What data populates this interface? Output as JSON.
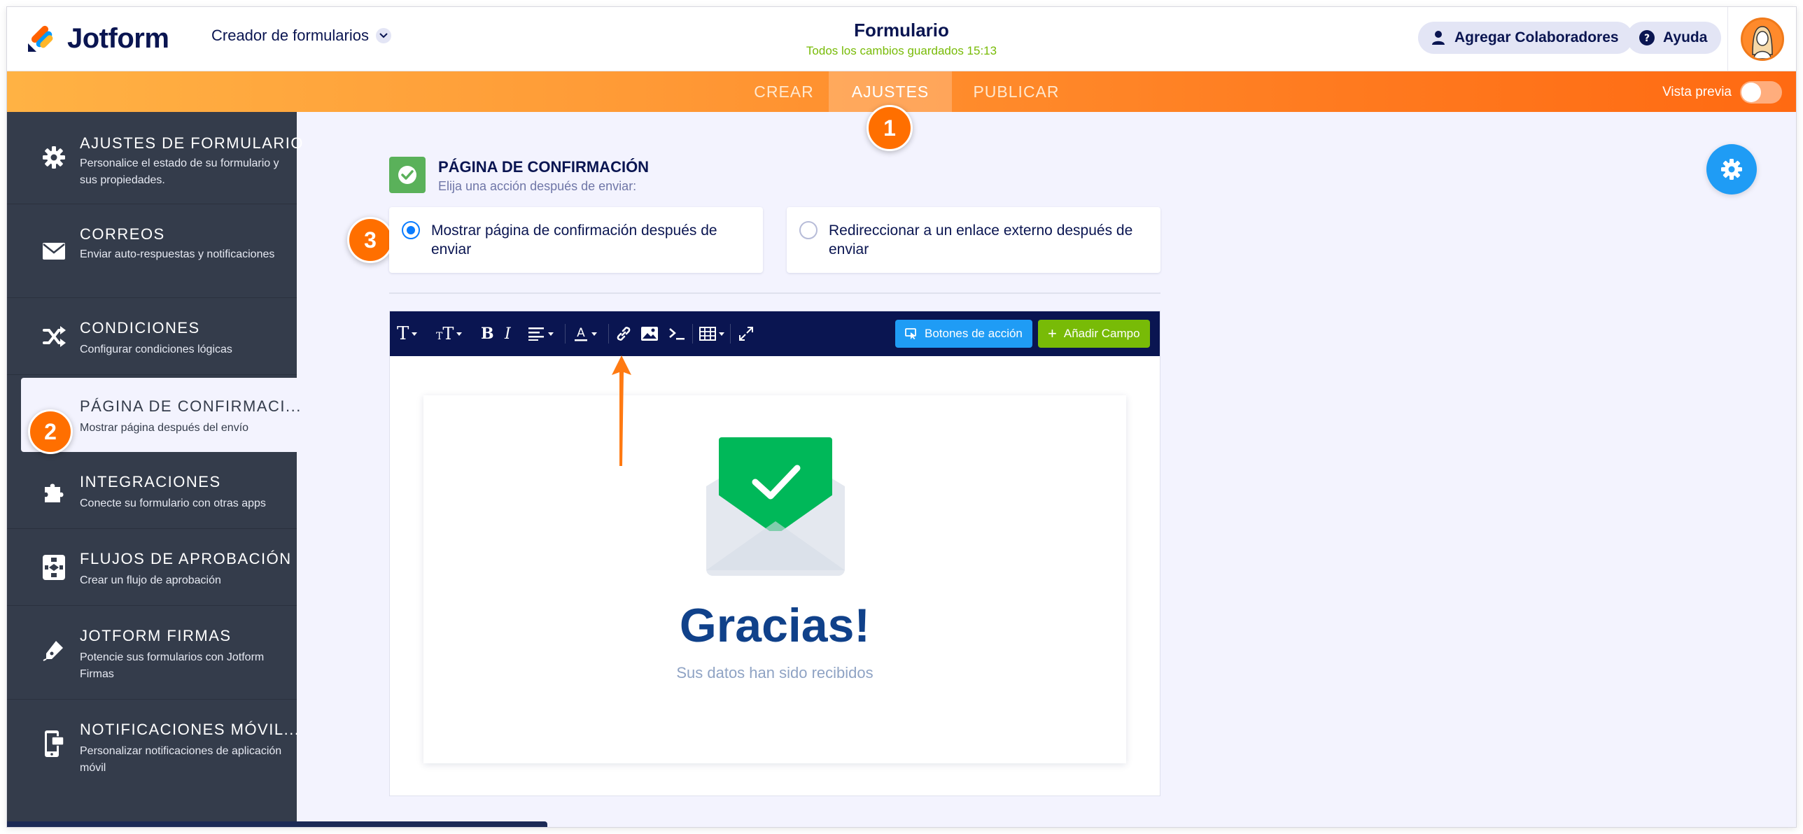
{
  "header": {
    "brand": "Jotform",
    "builder_label": "Creador de formularios",
    "form_title": "Formulario",
    "save_status": "Todos los cambios guardados 15:13",
    "collaborators_label": "Agregar Colaboradores",
    "help_label": "Ayuda"
  },
  "nav": {
    "tabs": [
      {
        "label": "CREAR"
      },
      {
        "label": "AJUSTES"
      },
      {
        "label": "PUBLICAR"
      }
    ],
    "preview_label": "Vista previa"
  },
  "sidebar": {
    "items": [
      {
        "title": "AJUSTES DE FORMULARIO",
        "desc": "Personalice el estado de su formulario y sus propiedades."
      },
      {
        "title": "CORREOS",
        "desc": "Enviar auto-respuestas y notificaciones"
      },
      {
        "title": "CONDICIONES",
        "desc": "Configurar condiciones lógicas"
      },
      {
        "title": "PÁGINA DE CONFIRMACI...",
        "desc": "Mostrar página después del envío"
      },
      {
        "title": "INTEGRACIONES",
        "desc": "Conecte su formulario con otras apps"
      },
      {
        "title": "FLUJOS DE APROBACIÓN",
        "desc": "Crear un flujo de aprobación"
      },
      {
        "title": "JOTFORM FIRMAS",
        "desc": "Potencie sus formularios con Jotform Firmas"
      },
      {
        "title": "NOTIFICACIONES MÓVIL...",
        "desc": "Personalizar notificaciones de aplicación móvil"
      }
    ]
  },
  "badges": {
    "one": "1",
    "two": "2",
    "three": "3"
  },
  "confirmation": {
    "title": "PÁGINA DE CONFIRMACIÓN",
    "subtitle": "Elija una acción después de enviar:",
    "options": [
      {
        "label": "Mostrar página de confirmación después de enviar",
        "selected": true
      },
      {
        "label": "Redireccionar a un enlace externo después de enviar",
        "selected": false
      }
    ]
  },
  "editor": {
    "action_buttons_label": "Botones de acción",
    "add_field_label": "Añadir Campo",
    "thanks_heading": "Gracias!",
    "thanks_message": "Sus datos han sido recibidos"
  },
  "colors": {
    "brand_navy": "#0a1551",
    "orange": "#ff6f00",
    "blue": "#1f9cf5",
    "green": "#78bb07"
  }
}
